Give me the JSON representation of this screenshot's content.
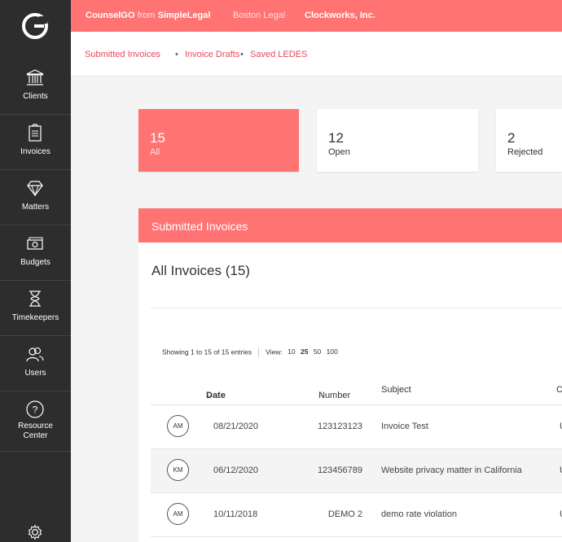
{
  "topbar": {
    "brand_app": "CounselGO",
    "brand_from": " from ",
    "brand_company": "SimpleLegal",
    "org1": "Boston Legal",
    "org2": "Clockworks, Inc."
  },
  "subnav": {
    "items": [
      "Submitted Invoices",
      "Invoice Drafts",
      "Saved LEDES"
    ],
    "separator": "•"
  },
  "sidebar": {
    "items": [
      {
        "label": "Clients",
        "icon": "bank-icon"
      },
      {
        "label": "Invoices",
        "icon": "clipboard-icon"
      },
      {
        "label": "Matters",
        "icon": "diamond-icon"
      },
      {
        "label": "Budgets",
        "icon": "money-icon"
      },
      {
        "label": "Timekeepers",
        "icon": "hourglass-icon"
      },
      {
        "label": "Users",
        "icon": "users-icon"
      },
      {
        "label_line1": "Resource",
        "label_line2": "Center",
        "icon": "help-icon"
      }
    ]
  },
  "stats": [
    {
      "value": "15",
      "label": "All"
    },
    {
      "value": "12",
      "label": "Open"
    },
    {
      "value": "2",
      "label": "Rejected"
    }
  ],
  "panel": {
    "header": "Submitted Invoices",
    "title": "All Invoices (15)",
    "entries_text": "Showing 1 to 15 of 15 entries",
    "view_label": "View:",
    "page_sizes": [
      "10",
      "25",
      "50",
      "100"
    ]
  },
  "table": {
    "columns": {
      "date": "Date",
      "number": "Number",
      "subject": "Subject",
      "c": "C"
    },
    "rows": [
      {
        "initials": "AM",
        "date": "08/21/2020",
        "number": "123123123",
        "subject": "Invoice Test",
        "c": "U"
      },
      {
        "initials": "KM",
        "date": "06/12/2020",
        "number": "123456789",
        "subject": "Website privacy matter in California",
        "c": "U"
      },
      {
        "initials": "AM",
        "date": "10/11/2018",
        "number": "DEMO 2",
        "subject": "demo rate violation",
        "c": "U"
      }
    ]
  },
  "colors": {
    "accent": "#ff7373",
    "sidebar": "#2d2d2d",
    "link": "#e64a5a"
  }
}
